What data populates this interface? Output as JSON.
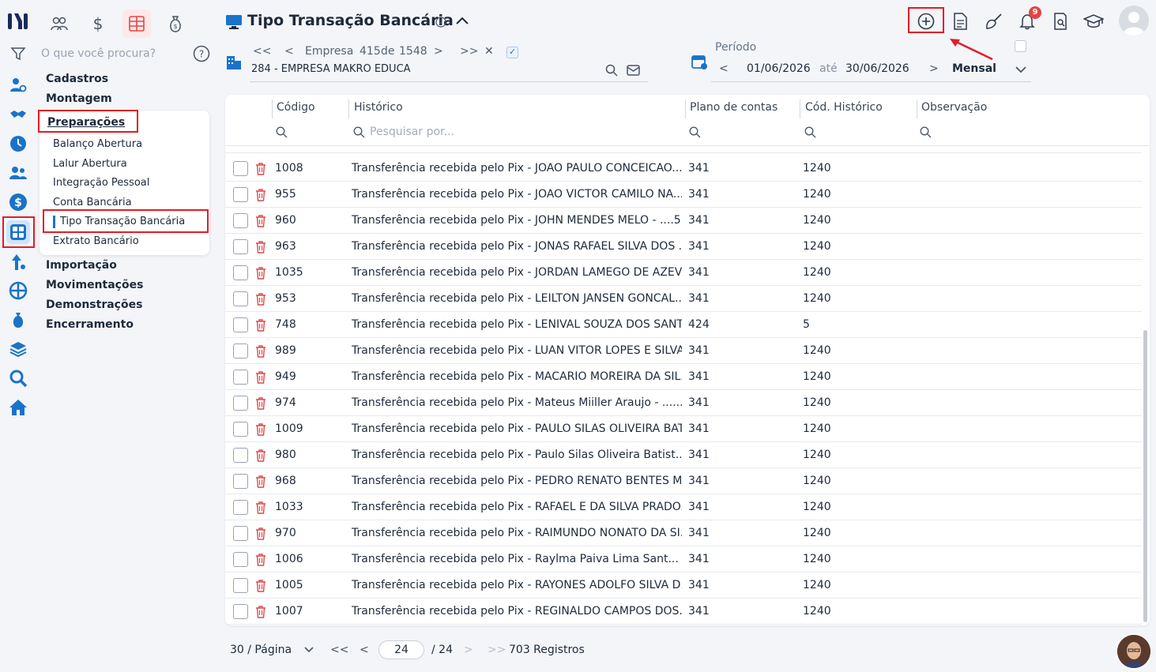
{
  "app": {
    "title": "Tipo Transação Bancária"
  },
  "sidebar": {
    "search_placeholder": "O que você procura?",
    "sections": [
      "Cadastros",
      "Montagem",
      "Preparações",
      "Importação",
      "Movimentações",
      "Demonstrações",
      "Encerramento"
    ],
    "preparacoes_items": [
      "Balanço Abertura",
      "Lalur Abertura",
      "Integração Pessoal",
      "Conta Bancária",
      "Tipo Transação Bancária",
      "Extrato Bancário"
    ],
    "active_item": "Tipo Transação Bancária"
  },
  "company": {
    "nav_label": "Empresa",
    "current": "415",
    "de_label": "de",
    "total": "1548",
    "name": "284 - EMPRESA MAKRO EDUCA"
  },
  "period": {
    "label": "Período",
    "start": "01/06/2026",
    "ate_label": "até",
    "end": "30/06/2026",
    "mode": "Mensal"
  },
  "notifications": {
    "count": "9"
  },
  "grid": {
    "columns": [
      "Código",
      "Histórico",
      "Plano de contas",
      "Cód. Histórico",
      "Observação"
    ],
    "search_placeholder": "Pesquisar por...",
    "rows": [
      {
        "codigo": "1008",
        "historico": "Transferência recebida pelo Pix - JOAO PAULO CONCEICAO...",
        "plano": "341",
        "cod_hist": "1240"
      },
      {
        "codigo": "955",
        "historico": "Transferência recebida pelo Pix - JOAO VICTOR CAMILO NA...",
        "plano": "341",
        "cod_hist": "1240"
      },
      {
        "codigo": "960",
        "historico": "Transferência recebida pelo Pix - JOHN MENDES MELO - ....5...",
        "plano": "341",
        "cod_hist": "1240"
      },
      {
        "codigo": "963",
        "historico": "Transferência recebida pelo Pix - JONAS RAFAEL SILVA DOS ...",
        "plano": "341",
        "cod_hist": "1240"
      },
      {
        "codigo": "1035",
        "historico": "Transferência recebida pelo Pix - JORDAN LAMEGO DE AZEV...",
        "plano": "341",
        "cod_hist": "1240"
      },
      {
        "codigo": "953",
        "historico": "Transferência recebida pelo Pix - LEILTON JANSEN GONCAL...",
        "plano": "341",
        "cod_hist": "1240"
      },
      {
        "codigo": "748",
        "historico": "Transferência recebida pelo Pix - LENIVAL SOUZA DOS SANT...",
        "plano": "424",
        "cod_hist": "5"
      },
      {
        "codigo": "989",
        "historico": "Transferência recebida pelo Pix - LUAN VITOR LOPES E SILVA...",
        "plano": "341",
        "cod_hist": "1240"
      },
      {
        "codigo": "949",
        "historico": "Transferência recebida pelo Pix - MACARIO MOREIRA DA SIL...",
        "plano": "341",
        "cod_hist": "1240"
      },
      {
        "codigo": "974",
        "historico": "Transferência recebida pelo Pix - Mateus Miiller Araujo - ......",
        "plano": "341",
        "cod_hist": "1240"
      },
      {
        "codigo": "1009",
        "historico": "Transferência recebida pelo Pix - PAULO SILAS OLIVEIRA BAT...",
        "plano": "341",
        "cod_hist": "1240"
      },
      {
        "codigo": "980",
        "historico": "Transferência recebida pelo Pix - Paulo Silas Oliveira Batist...",
        "plano": "341",
        "cod_hist": "1240"
      },
      {
        "codigo": "968",
        "historico": "Transferência recebida pelo Pix - PEDRO RENATO BENTES M...",
        "plano": "341",
        "cod_hist": "1240"
      },
      {
        "codigo": "1033",
        "historico": "Transferência recebida pelo Pix - RAFAEL E DA SILVA PRADO...",
        "plano": "341",
        "cod_hist": "1240"
      },
      {
        "codigo": "970",
        "historico": "Transferência recebida pelo Pix - RAIMUNDO NONATO DA SI...",
        "plano": "341",
        "cod_hist": "1240"
      },
      {
        "codigo": "1006",
        "historico": "Transferência recebida pelo Pix - Raylma Paiva Lima Sant...",
        "plano": "341",
        "cod_hist": "1240"
      },
      {
        "codigo": "1005",
        "historico": "Transferência recebida pelo Pix - RAYONES ADOLFO SILVA D...",
        "plano": "341",
        "cod_hist": "1240"
      },
      {
        "codigo": "1007",
        "historico": "Transferência recebida pelo Pix - REGINALDO CAMPOS DOS...",
        "plano": "341",
        "cod_hist": "1240"
      }
    ]
  },
  "pagination": {
    "per_page": "30 / Página",
    "current_page": "24",
    "total_pages": "/ 24",
    "records": "703 Registros"
  },
  "colors": {
    "accent_red": "#e11d25",
    "brand_blue": "#1a73c9",
    "trash_red": "#e04848"
  }
}
